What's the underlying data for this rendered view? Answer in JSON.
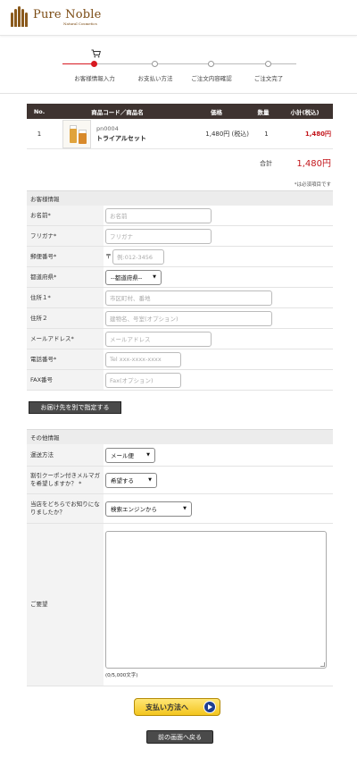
{
  "brand": {
    "name": "Pure Noble",
    "tagline": "Natural Cosmetics"
  },
  "steps": [
    {
      "label": "お客様情報入力",
      "active": true
    },
    {
      "label": "お支払い方法",
      "active": false
    },
    {
      "label": "ご注文内容確認",
      "active": false
    },
    {
      "label": "ご注文完了",
      "active": false
    }
  ],
  "cart_table": {
    "headers": [
      "No.",
      "商品コード／商品名",
      "価格",
      "数量",
      "小計(税込)"
    ],
    "rows": [
      {
        "no": "1",
        "code": "pn0004",
        "name": "トライアルセット",
        "price": "1,480円 (税込)",
        "qty": "1",
        "subtotal": "1,480円"
      }
    ],
    "total_label": "合計",
    "total_value": "1,480円"
  },
  "required_note": "*は必須項目です",
  "customer": {
    "heading": "お客様情報",
    "name_label": "お名前*",
    "name_ph": "お名前",
    "kana_label": "フリガナ*",
    "kana_ph": "フリガナ",
    "zip_label": "郵便番号*",
    "zip_mark": "〒",
    "zip_ph": "例:012-3456",
    "pref_label": "都道府県*",
    "pref_value": "--都道府県--",
    "addr1_label": "住所１*",
    "addr1_ph": "市区町村、番地",
    "addr2_label": "住所２",
    "addr2_ph": "建物名、号室(オプション)",
    "email_label": "メールアドレス*",
    "email_ph": "メールアドレス",
    "tel_label": "電話番号*",
    "tel_ph": "Tel xxx-xxxx-xxxx",
    "fax_label": "FAX番号",
    "fax_ph": "Fax(オプション)"
  },
  "ship_other_button": "お届け先を別で指定する",
  "other": {
    "heading": "その他情報",
    "delivery_label": "運送方法",
    "delivery_value": "メール便",
    "mag_label": "割引クーポン付きメルマガを希望しますか？ *",
    "mag_value": "希望する",
    "source_label": "当店をどちらでお知りになりましたか？",
    "source_value": "検索エンジンから",
    "request_label": "ご要望",
    "char_count": "(0/5,000文字)"
  },
  "pay_button": "支払い方法へ",
  "back_button": "前の画面へ戻る",
  "colors": {
    "brand": "#7a4a12",
    "accent_red": "#c3161c",
    "table_head": "#3e3330"
  }
}
